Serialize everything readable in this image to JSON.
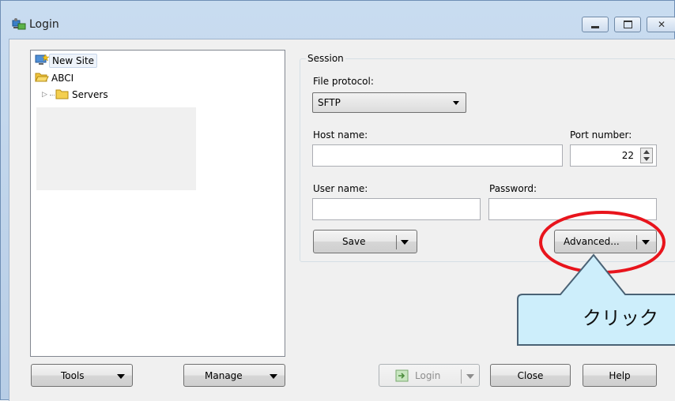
{
  "window": {
    "title": "Login",
    "controls": [
      "minimize",
      "maximize",
      "close"
    ]
  },
  "site_tree": {
    "items": [
      {
        "label": "New Site",
        "icon": "new-site-icon",
        "selected": true
      },
      {
        "label": "ABCI",
        "icon": "folder-open-icon"
      },
      {
        "label": "Servers",
        "icon": "folder-icon"
      }
    ]
  },
  "session": {
    "group_title": "Session",
    "file_protocol_label": "File protocol:",
    "file_protocol_value": "SFTP",
    "host_name_label": "Host name:",
    "host_name_value": "",
    "port_number_label": "Port number:",
    "port_number_value": "22",
    "user_name_label": "User name:",
    "user_name_value": "",
    "password_label": "Password:",
    "password_value": "",
    "save_label": "Save",
    "advanced_label": "Advanced..."
  },
  "footer": {
    "tools_label": "Tools",
    "manage_label": "Manage",
    "login_label": "Login",
    "close_label": "Close",
    "help_label": "Help"
  },
  "annotation": {
    "callout_text": "クリック",
    "highlight_color": "#e8141c",
    "callout_fill": "#cdeefb"
  }
}
